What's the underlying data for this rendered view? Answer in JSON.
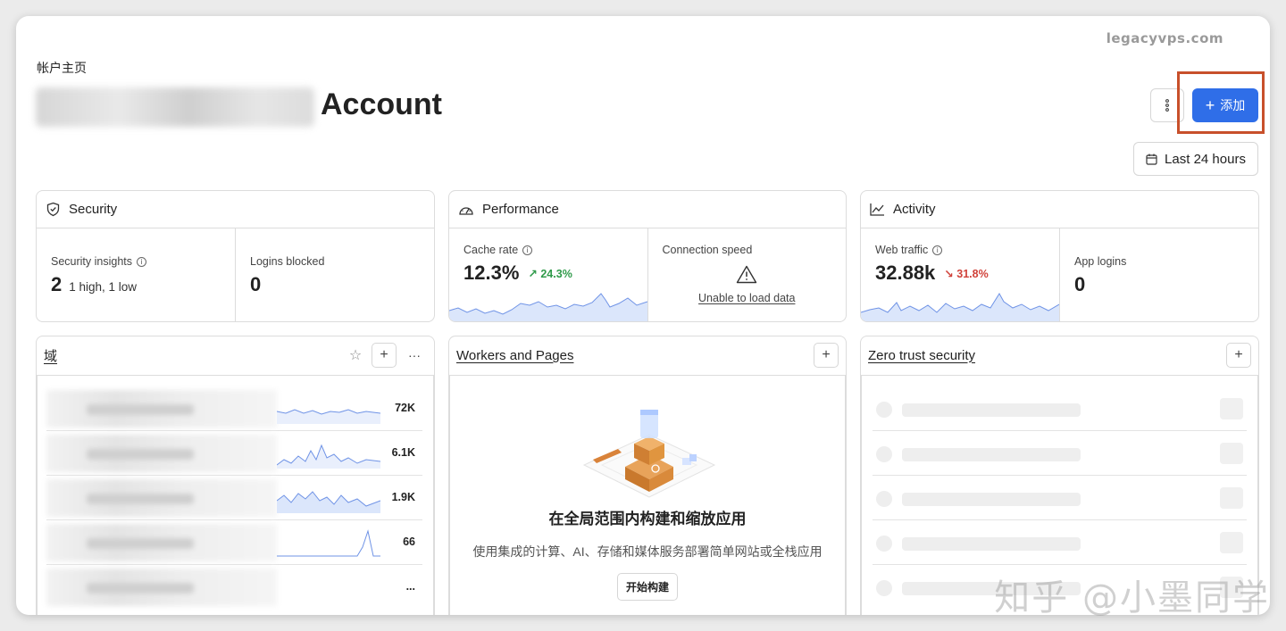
{
  "watermark_top": "legacyvps.com",
  "watermark_bottom": "知乎 @小墨同学",
  "header": {
    "breadcrumb": "帐户主页",
    "title": "Account",
    "add_label": "添加",
    "range_label": "Last 24 hours"
  },
  "security": {
    "title": "Security",
    "insights_label": "Security insights",
    "insights_value": "2",
    "insights_detail": "1 high, 1 low",
    "logins_label": "Logins blocked",
    "logins_value": "0"
  },
  "performance": {
    "title": "Performance",
    "cache_label": "Cache rate",
    "cache_value": "12.3%",
    "cache_delta": "24.3%",
    "speed_label": "Connection speed",
    "speed_error": "Unable to load data"
  },
  "activity": {
    "title": "Activity",
    "traffic_label": "Web traffic",
    "traffic_value": "32.88k",
    "traffic_delta": "31.8%",
    "app_label": "App logins",
    "app_value": "0"
  },
  "domains": {
    "title": "域",
    "rows": [
      {
        "value": "72K"
      },
      {
        "value": "6.1K"
      },
      {
        "value": "1.9K"
      },
      {
        "value": "66"
      },
      {
        "value": "..."
      }
    ]
  },
  "workers": {
    "title": "Workers and Pages",
    "headline": "在全局范围内构建和缩放应用",
    "description": "使用集成的计算、AI、存储和媒体服务部署简单网站或全栈应用",
    "cta": "开始构建"
  },
  "zerotrust": {
    "title": "Zero trust security"
  },
  "colors": {
    "accent": "#2f6ee8",
    "highlight": "#c8502b",
    "positive": "#2f9a4a",
    "negative": "#d0423a"
  }
}
